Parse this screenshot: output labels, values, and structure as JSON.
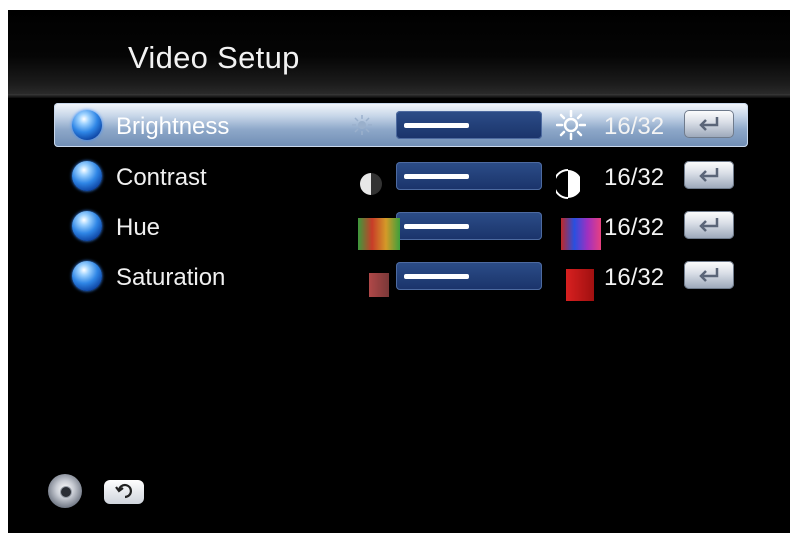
{
  "screen": {
    "title": "Video Setup"
  },
  "settings": [
    {
      "label": "Brightness",
      "value_text": "16/32",
      "level": 0.5,
      "selected": true
    },
    {
      "label": "Contrast",
      "value_text": "16/32",
      "level": 0.5,
      "selected": false
    },
    {
      "label": "Hue",
      "value_text": "16/32",
      "level": 0.5,
      "selected": false
    },
    {
      "label": "Saturation",
      "value_text": "16/32",
      "level": 0.5,
      "selected": false
    }
  ],
  "footer": {
    "icons": [
      "dpad-navigation-icon",
      "back-return-icon"
    ]
  },
  "colors": {
    "background": "#000000",
    "selection_highlight": "#8ea8c9",
    "slider_track": "#1a336a",
    "slider_fill": "#ffffff",
    "enter_button": "#d8dde6"
  }
}
